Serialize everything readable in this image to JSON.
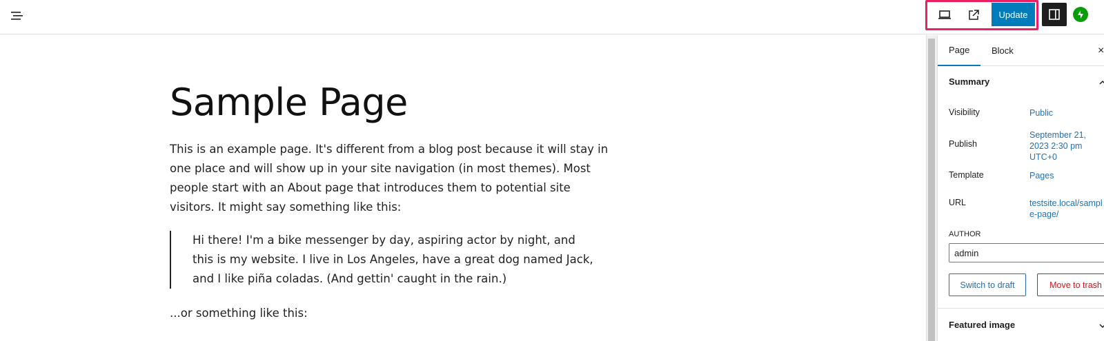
{
  "toolbar": {
    "update_label": "Update",
    "icons": [
      "document-overview-icon",
      "desktop-preview-icon",
      "external-view-icon",
      "settings-sidebar-icon",
      "jetpack-icon"
    ],
    "highlight_color": "#e91e63",
    "accent_color": "#007cba"
  },
  "content": {
    "title": "Sample Page",
    "paragraph": "This is an example page. It's different from a blog post because it will stay in one place and will show up in your site navigation (in most themes). Most people start with an About page that introduces them to potential site visitors. It might say something like this:",
    "quote": "Hi there! I'm a bike messenger by day, aspiring actor by night, and this is my website. I live in Los Angeles, have a great dog named Jack, and I like piña coladas. (And gettin' caught in the rain.)",
    "paragraph2": "...or something like this:"
  },
  "sidebar": {
    "tabs": [
      {
        "label": "Page"
      },
      {
        "label": "Block"
      }
    ],
    "close": "×",
    "summary": {
      "title": "Summary",
      "visibility_label": "Visibility",
      "visibility_value": "Public",
      "publish_label": "Publish",
      "publish_value": "September 21, 2023 2:30 pm UTC+0",
      "template_label": "Template",
      "template_value": "Pages",
      "url_label": "URL",
      "url_value": "testsite.local/sample-page/",
      "author_label": "AUTHOR",
      "author_value": "admin",
      "switch_draft_label": "Switch to draft",
      "move_trash_label": "Move to trash"
    },
    "featured_image_title": "Featured image"
  }
}
